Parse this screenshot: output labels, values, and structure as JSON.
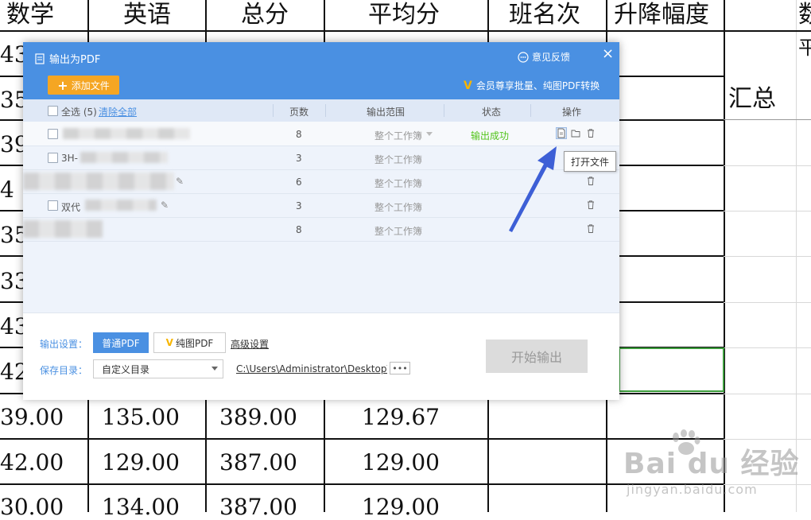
{
  "sheet": {
    "headers": [
      "数学",
      "英语",
      "总分",
      "平均分",
      "班名次",
      "升降幅度",
      "数"
    ],
    "summary_label": "汇总",
    "col_right_partial": "平",
    "left_col_partial": [
      "43",
      "35",
      "39",
      "4",
      "35",
      "33",
      "43",
      "42"
    ],
    "rows": [
      [
        "39.00",
        "135.00",
        "389.00",
        "129.67"
      ],
      [
        "42.00",
        "129.00",
        "387.00",
        "129.00"
      ],
      [
        "30.00",
        "134.00",
        "387.00",
        "129.00"
      ]
    ]
  },
  "watermark": {
    "main": "Bai du 经验",
    "sub": "jingyan.baidu.com"
  },
  "dialog": {
    "title": "输出为PDF",
    "feedback": "意见反馈",
    "close": "×",
    "add_file": "添加文件",
    "vip_note": "会员尊享批量、纯图PDF转换",
    "table": {
      "select_all": "全选 (5)",
      "clear_all": "清除全部",
      "col_pages": "页数",
      "col_range": "输出范围",
      "col_status": "状态",
      "col_ops": "操作",
      "rows": [
        {
          "name_visible": "",
          "pages": "8",
          "range": "整个工作簿",
          "status": "输出成功"
        },
        {
          "name_visible": "3H-",
          "pages": "3",
          "range": "整个工作簿",
          "status": ""
        },
        {
          "name_visible": "",
          "pages": "6",
          "range": "整个工作簿",
          "status": ""
        },
        {
          "name_visible": "双代",
          "pages": "3",
          "range": "整个工作簿",
          "status": ""
        },
        {
          "name_visible": "",
          "pages": "8",
          "range": "整个工作簿",
          "status": ""
        }
      ]
    },
    "tooltip": "打开文件",
    "footer": {
      "output_settings_label": "输出设置：",
      "mode_normal": "普通PDF",
      "mode_image": "纯图PDF",
      "advanced": "高级设置",
      "save_dir_label": "保存目录：",
      "save_dir_value": "自定义目录",
      "save_path": "C:\\Users\\Administrator\\Desktop\\",
      "more": "•••",
      "start": "开始输出"
    }
  },
  "colors": {
    "accent": "#4a90e2",
    "add_button": "#f5a623",
    "success": "#52c41a",
    "selection": "#3c9d3c"
  }
}
